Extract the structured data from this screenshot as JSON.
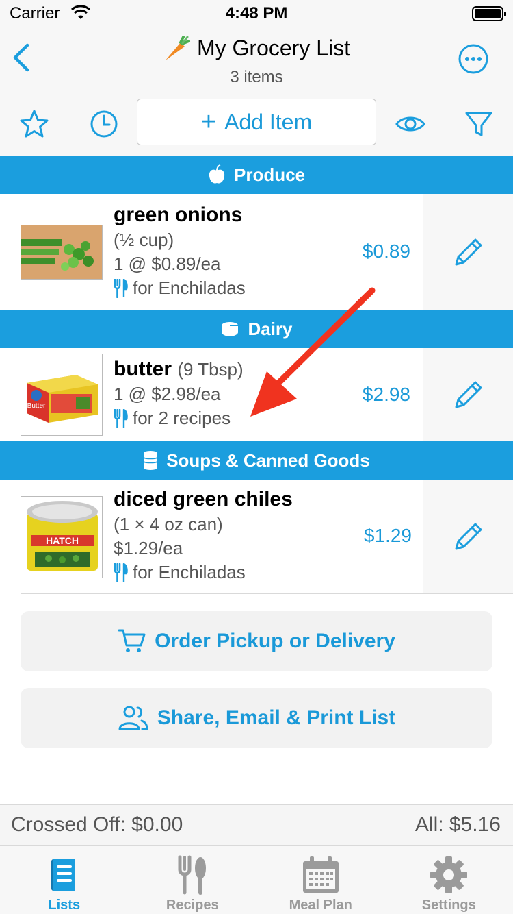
{
  "status": {
    "carrier": "Carrier",
    "time": "4:48 PM"
  },
  "nav": {
    "title": "My Grocery List",
    "subtitle": "3 items"
  },
  "toolbar": {
    "add_item_label": "Add Item"
  },
  "categories": [
    {
      "name": "Produce",
      "icon": "apple-icon",
      "items": [
        {
          "name": "green onions",
          "qty": "(½ cup)",
          "unit_price": "1 @ $0.89/ea",
          "recipe": "for Enchiladas",
          "price": "$0.89"
        }
      ]
    },
    {
      "name": "Dairy",
      "icon": "cheese-icon",
      "items": [
        {
          "name": "butter",
          "qty": "(9 Tbsp)",
          "unit_price": "1 @ $2.98/ea",
          "recipe": "for 2 recipes",
          "price": "$2.98"
        }
      ]
    },
    {
      "name": "Soups & Canned Goods",
      "icon": "can-icon",
      "items": [
        {
          "name": "diced green chiles",
          "qty": "(1 × 4 oz can)",
          "unit_price": "$1.29/ea",
          "recipe": "for Enchiladas",
          "price": "$1.29"
        }
      ]
    }
  ],
  "actions": {
    "order_label": "Order Pickup or Delivery",
    "share_label": "Share, Email & Print List"
  },
  "totals": {
    "crossed_off": "Crossed Off: $0.00",
    "all": "All: $5.16"
  },
  "tabs": [
    {
      "label": "Lists",
      "active": true
    },
    {
      "label": "Recipes",
      "active": false
    },
    {
      "label": "Meal Plan",
      "active": false
    },
    {
      "label": "Settings",
      "active": false
    }
  ],
  "colors": {
    "accent": "#1b9ede",
    "header": "#1b9ede",
    "arrow": "#f0331f",
    "inactive_tab": "#9b9b9b"
  }
}
